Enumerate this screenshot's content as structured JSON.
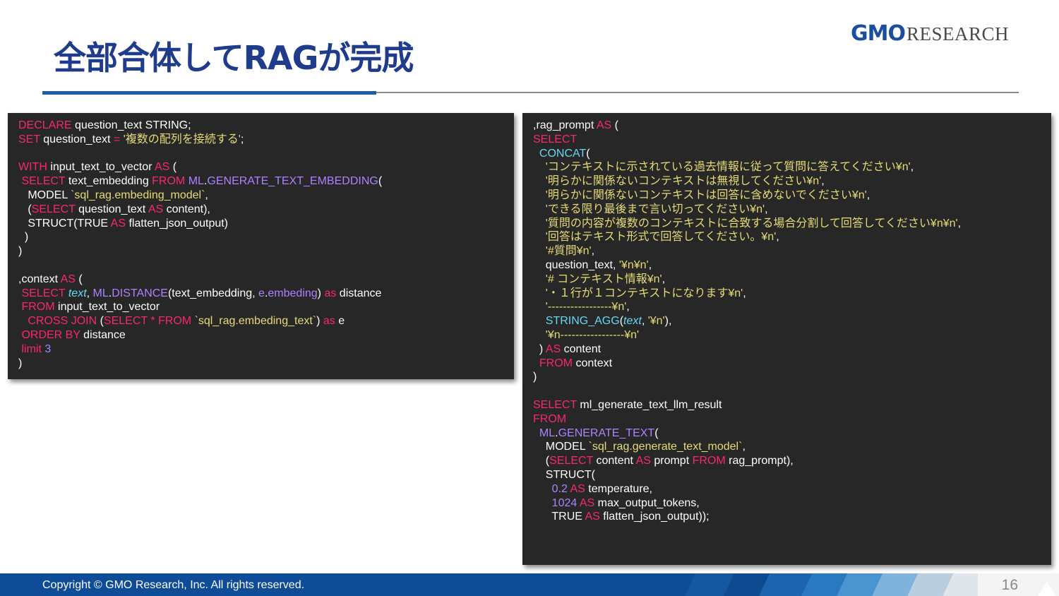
{
  "slide": {
    "title": "全部合体してRAGが完成",
    "logo_gmo": "GMO",
    "logo_research": "RESEARCH",
    "copyright": "Copyright © GMO Research, Inc. All rights reserved.",
    "page_number": "16"
  },
  "colors": {
    "title": "#1f3b8c",
    "code_background": "#272727",
    "keyword": "#f92672",
    "function": "#ae81ff",
    "string": "#e6db74",
    "identifier": "#66d9ef",
    "footer": "#0f4c97"
  },
  "code_left": [
    [
      [
        "kw",
        "DECLARE"
      ],
      [
        "p",
        " question_text STRING;"
      ]
    ],
    [
      [
        "kw",
        "SET"
      ],
      [
        "p",
        " question_text "
      ],
      [
        "kw",
        "="
      ],
      [
        "p",
        " "
      ],
      [
        "st",
        "'複数の配列を接続する'"
      ],
      [
        "p",
        ";"
      ]
    ],
    [],
    [
      [
        "kw",
        "WITH"
      ],
      [
        "p",
        " input_text_to_vector "
      ],
      [
        "kw",
        "AS"
      ],
      [
        "p",
        " ("
      ]
    ],
    [
      [
        "p",
        " "
      ],
      [
        "kw",
        "SELECT"
      ],
      [
        "p",
        " text_embedding "
      ],
      [
        "kw",
        "FROM"
      ],
      [
        "p",
        " "
      ],
      [
        "fn",
        "ML"
      ],
      [
        "p",
        "."
      ],
      [
        "fn",
        "GENERATE_TEXT_EMBEDDING"
      ],
      [
        "p",
        "("
      ]
    ],
    [
      [
        "p",
        "   MODEL "
      ],
      [
        "st",
        "`sql_rag.embeding_model`"
      ],
      [
        "p",
        ","
      ]
    ],
    [
      [
        "p",
        "   ("
      ],
      [
        "kw",
        "SELECT"
      ],
      [
        "p",
        " question_text "
      ],
      [
        "kw",
        "AS"
      ],
      [
        "p",
        " content),"
      ]
    ],
    [
      [
        "p",
        "   STRUCT(TRUE "
      ],
      [
        "kw",
        "AS"
      ],
      [
        "p",
        " flatten_json_output)"
      ]
    ],
    [
      [
        "p",
        "  )"
      ]
    ],
    [
      [
        "p",
        ")"
      ]
    ],
    [],
    [
      [
        "p",
        ",context "
      ],
      [
        "kw",
        "AS"
      ],
      [
        "p",
        " ("
      ]
    ],
    [
      [
        "p",
        " "
      ],
      [
        "kw",
        "SELECT"
      ],
      [
        "p",
        " "
      ],
      [
        "it",
        "text"
      ],
      [
        "p",
        ", "
      ],
      [
        "fn",
        "ML"
      ],
      [
        "p",
        "."
      ],
      [
        "fn",
        "DISTANCE"
      ],
      [
        "p",
        "(text_embedding, "
      ],
      [
        "fn",
        "e"
      ],
      [
        "p",
        "."
      ],
      [
        "fn",
        "embeding"
      ],
      [
        "p",
        ") "
      ],
      [
        "kw",
        "as"
      ],
      [
        "p",
        " distance"
      ]
    ],
    [
      [
        "p",
        " "
      ],
      [
        "kw",
        "FROM"
      ],
      [
        "p",
        " input_text_to_vector"
      ]
    ],
    [
      [
        "p",
        "   "
      ],
      [
        "kw",
        "CROSS JOIN"
      ],
      [
        "p",
        " ("
      ],
      [
        "kw",
        "SELECT"
      ],
      [
        "p",
        " "
      ],
      [
        "kw",
        "*"
      ],
      [
        "p",
        " "
      ],
      [
        "kw",
        "FROM"
      ],
      [
        "p",
        " "
      ],
      [
        "st",
        "`sql_rag.embeding_text`"
      ],
      [
        "p",
        ") "
      ],
      [
        "kw",
        "as"
      ],
      [
        "p",
        " e"
      ]
    ],
    [
      [
        "p",
        " "
      ],
      [
        "kw",
        "ORDER BY"
      ],
      [
        "p",
        " distance"
      ]
    ],
    [
      [
        "p",
        " "
      ],
      [
        "kw",
        "limit"
      ],
      [
        "p",
        " "
      ],
      [
        "fn",
        "3"
      ]
    ],
    [
      [
        "p",
        ")"
      ]
    ]
  ],
  "code_right": [
    [
      [
        "p",
        ",rag_prompt "
      ],
      [
        "kw",
        "AS"
      ],
      [
        "p",
        " ("
      ]
    ],
    [
      [
        "kw",
        "SELECT"
      ]
    ],
    [
      [
        "p",
        "  "
      ],
      [
        "ct",
        "CONCAT"
      ],
      [
        "p",
        "("
      ]
    ],
    [
      [
        "p",
        "    "
      ],
      [
        "st",
        "'コンテキストに示されている過去情報に従って質問に答えてください¥n'"
      ],
      [
        "p",
        ","
      ]
    ],
    [
      [
        "p",
        "    "
      ],
      [
        "st",
        "'明らかに関係ないコンテキストは無視してください¥n'"
      ],
      [
        "p",
        ","
      ]
    ],
    [
      [
        "p",
        "    "
      ],
      [
        "st",
        "'明らかに関係ないコンテキストは回答に含めないでください¥n'"
      ],
      [
        "p",
        ","
      ]
    ],
    [
      [
        "p",
        "    "
      ],
      [
        "st",
        "'できる限り最後まで言い切ってください¥n'"
      ],
      [
        "p",
        ","
      ]
    ],
    [
      [
        "p",
        "    "
      ],
      [
        "st",
        "'質問の内容が複数のコンテキストに合致する場合分割して回答してください¥n¥n'"
      ],
      [
        "p",
        ","
      ]
    ],
    [
      [
        "p",
        "    "
      ],
      [
        "st",
        "'回答はテキスト形式で回答してください。¥n'"
      ],
      [
        "p",
        ","
      ]
    ],
    [
      [
        "p",
        "    "
      ],
      [
        "st",
        "'#質問¥n'"
      ],
      [
        "p",
        ","
      ]
    ],
    [
      [
        "p",
        "    question_text, "
      ],
      [
        "st",
        "'¥n¥n'"
      ],
      [
        "p",
        ","
      ]
    ],
    [
      [
        "p",
        "    "
      ],
      [
        "st",
        "'# コンテキスト情報¥n'"
      ],
      [
        "p",
        ","
      ]
    ],
    [
      [
        "p",
        "    "
      ],
      [
        "st",
        "'・１行が１コンテキストになります¥n'"
      ],
      [
        "p",
        ","
      ]
    ],
    [
      [
        "p",
        "    "
      ],
      [
        "st",
        "'-----------------¥n'"
      ],
      [
        "p",
        ","
      ]
    ],
    [
      [
        "p",
        "    "
      ],
      [
        "ct",
        "STRING_AGG"
      ],
      [
        "p",
        "("
      ],
      [
        "it",
        "text"
      ],
      [
        "p",
        ", "
      ],
      [
        "st",
        "'¥n'"
      ],
      [
        "p",
        "),"
      ]
    ],
    [
      [
        "p",
        "    "
      ],
      [
        "st",
        "'¥n-----------------¥n'"
      ]
    ],
    [
      [
        "p",
        "  ) "
      ],
      [
        "kw",
        "AS"
      ],
      [
        "p",
        " content"
      ]
    ],
    [
      [
        "p",
        "  "
      ],
      [
        "kw",
        "FROM"
      ],
      [
        "p",
        " context"
      ]
    ],
    [
      [
        "p",
        ")"
      ]
    ],
    [],
    [
      [
        "kw",
        "SELECT"
      ],
      [
        "p",
        " ml_generate_text_llm_result"
      ]
    ],
    [
      [
        "kw",
        "FROM"
      ]
    ],
    [
      [
        "p",
        "  "
      ],
      [
        "fn",
        "ML"
      ],
      [
        "p",
        "."
      ],
      [
        "fn",
        "GENERATE_TEXT"
      ],
      [
        "p",
        "("
      ]
    ],
    [
      [
        "p",
        "    MODEL "
      ],
      [
        "st",
        "`sql_rag.generate_text_model`"
      ],
      [
        "p",
        ","
      ]
    ],
    [
      [
        "p",
        "    ("
      ],
      [
        "kw",
        "SELECT"
      ],
      [
        "p",
        " content "
      ],
      [
        "kw",
        "AS"
      ],
      [
        "p",
        " prompt "
      ],
      [
        "kw",
        "FROM"
      ],
      [
        "p",
        " rag_prompt),"
      ]
    ],
    [
      [
        "p",
        "    STRUCT("
      ]
    ],
    [
      [
        "p",
        "      "
      ],
      [
        "fn",
        "0.2"
      ],
      [
        "p",
        " "
      ],
      [
        "kw",
        "AS"
      ],
      [
        "p",
        " temperature,"
      ]
    ],
    [
      [
        "p",
        "      "
      ],
      [
        "fn",
        "1024"
      ],
      [
        "p",
        " "
      ],
      [
        "kw",
        "AS"
      ],
      [
        "p",
        " max_output_tokens,"
      ]
    ],
    [
      [
        "p",
        "      TRUE "
      ],
      [
        "kw",
        "AS"
      ],
      [
        "p",
        " flatten_json_output));"
      ]
    ]
  ]
}
